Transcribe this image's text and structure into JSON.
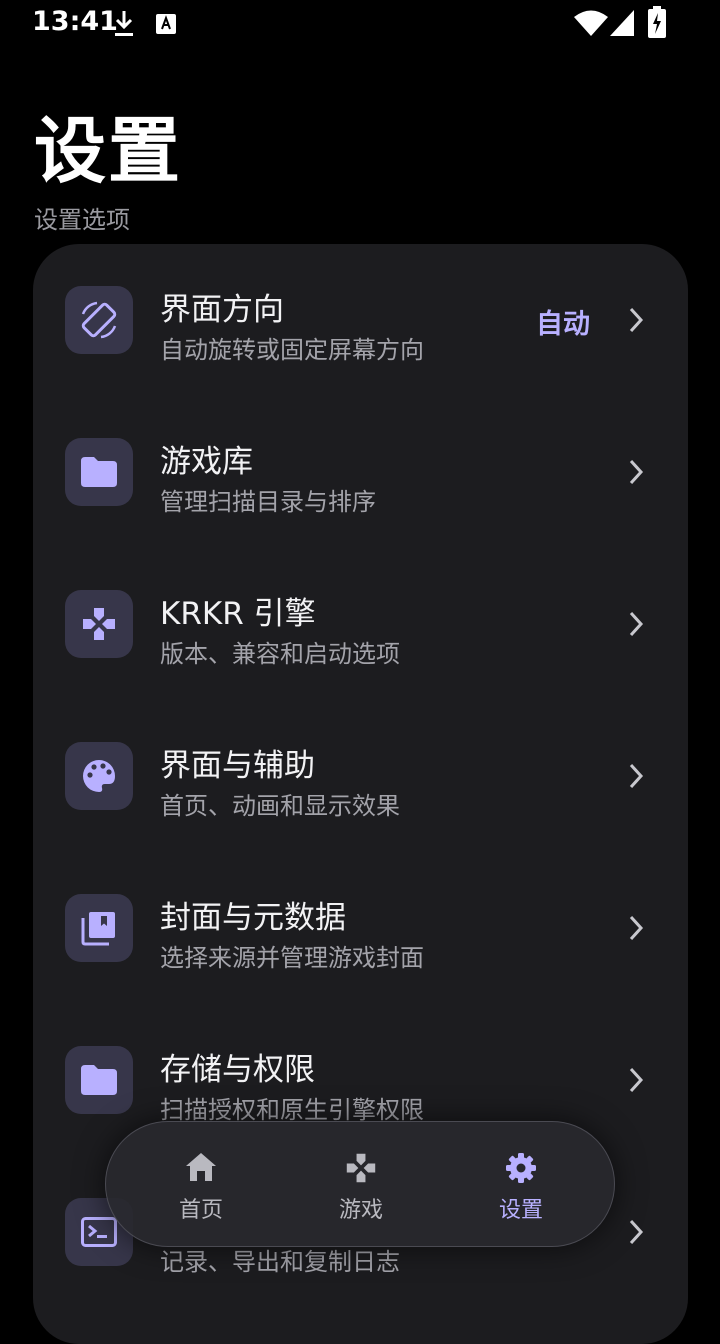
{
  "status_bar": {
    "time": "13:41",
    "icons": [
      "download-icon",
      "keyboard-a-icon",
      "wifi-icon",
      "signal-icon",
      "battery-charging-icon"
    ]
  },
  "page": {
    "title": "设置",
    "section_label": "设置选项"
  },
  "colors": {
    "accent": "#b8b0ff",
    "card_bg": "#1c1c1f",
    "icon_bg": "#37364a"
  },
  "settings": [
    {
      "icon": "screen-rotation-icon",
      "title": "界面方向",
      "subtitle": "自动旋转或固定屏幕方向",
      "value": "自动"
    },
    {
      "icon": "folder-icon",
      "title": "游戏库",
      "subtitle": "管理扫描目录与排序"
    },
    {
      "icon": "gamepad-icon",
      "title": "KRKR 引擎",
      "subtitle": "版本、兼容和启动选项"
    },
    {
      "icon": "palette-icon",
      "title": "界面与辅助",
      "subtitle": "首页、动画和显示效果"
    },
    {
      "icon": "library-image-icon",
      "title": "封面与元数据",
      "subtitle": "选择来源并管理游戏封面"
    },
    {
      "icon": "folder-icon",
      "title": "存储与权限",
      "subtitle": "扫描授权和原生引擎权限"
    },
    {
      "icon": "terminal-icon",
      "title": "",
      "subtitle": "记录、导出和复制日志"
    }
  ],
  "bottom_nav": [
    {
      "icon": "home-icon",
      "label": "首页",
      "active": false
    },
    {
      "icon": "gamepad-icon",
      "label": "游戏",
      "active": false
    },
    {
      "icon": "gear-icon",
      "label": "设置",
      "active": true
    }
  ]
}
